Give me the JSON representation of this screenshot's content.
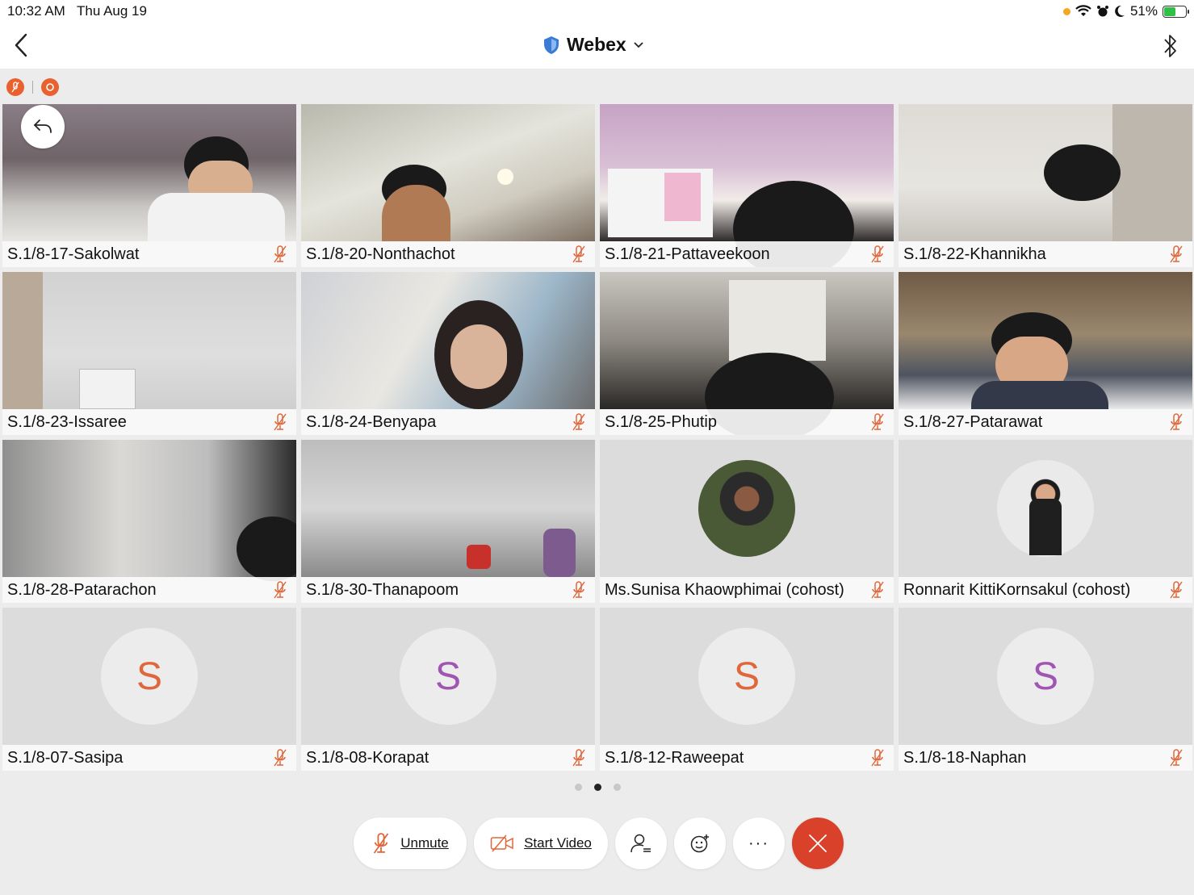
{
  "status_bar": {
    "time": "10:32 AM",
    "date": "Thu Aug 19",
    "battery": "51%"
  },
  "header": {
    "title": "Webex"
  },
  "participants": [
    {
      "name": "S.1/8-17-Sakolwat",
      "type": "video"
    },
    {
      "name": "S.1/8-20-Nonthachot",
      "type": "video"
    },
    {
      "name": "S.1/8-21-Pattaveekoon",
      "type": "video"
    },
    {
      "name": "S.1/8-22-Khannikha",
      "type": "video"
    },
    {
      "name": "S.1/8-23-Issaree",
      "type": "video"
    },
    {
      "name": "S.1/8-24-Benyapa",
      "type": "video"
    },
    {
      "name": "S.1/8-25-Phutip",
      "type": "video"
    },
    {
      "name": "S.1/8-27-Patarawat",
      "type": "video"
    },
    {
      "name": "S.1/8-28-Patarachon",
      "type": "video"
    },
    {
      "name": "S.1/8-30-Thanapoom",
      "type": "video"
    },
    {
      "name": "Ms.Sunisa Khaowphimai (cohost)",
      "type": "photo"
    },
    {
      "name": "Ronnarit KittiKornsakul (cohost)",
      "type": "photo"
    },
    {
      "name": "S.1/8-07-Sasipa",
      "type": "initial",
      "initial": "S",
      "color": "#e0673b"
    },
    {
      "name": "S.1/8-08-Korapat",
      "type": "initial",
      "initial": "S",
      "color": "#a055b2"
    },
    {
      "name": "S.1/8-12-Raweepat",
      "type": "initial",
      "initial": "S",
      "color": "#e0673b"
    },
    {
      "name": "S.1/8-18-Naphan",
      "type": "initial",
      "initial": "S",
      "color": "#a055b2"
    }
  ],
  "pager": {
    "pages": 3,
    "current": 2
  },
  "controls": {
    "unmute_label": "Unmute",
    "start_video_label": "Start Video",
    "participants_icon": "participants-icon",
    "reactions_icon": "reactions-icon",
    "more_label": "···",
    "end_icon": "close-icon"
  },
  "colors": {
    "accent_red": "#d9412b",
    "muted_mic": "#e0673b",
    "shield": "#3a7bd5"
  }
}
